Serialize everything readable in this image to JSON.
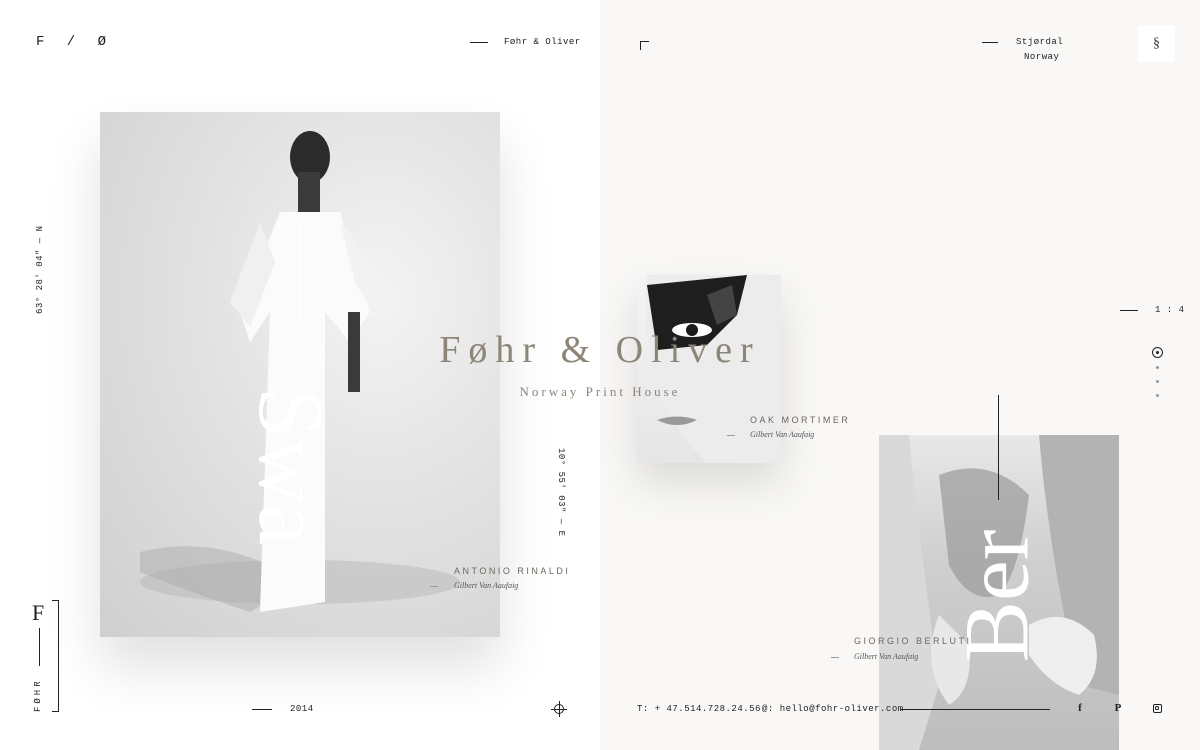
{
  "brand": {
    "logo": "F / Ø",
    "header_name": "Føhr & Oliver",
    "title": "Føhr & Oliver",
    "subtitle": "Norway Print House",
    "side_mark": "FØHR"
  },
  "location": {
    "city": "Stjørdal",
    "country": "Norway",
    "latitude": "63° 28' 04\" — N",
    "longitude": "10° 55' 03\" — E"
  },
  "slider": {
    "counter": "1 : 4"
  },
  "year": "2014",
  "contact": {
    "phone": "T: + 47.514.728.24.56",
    "email": "@: hello@fohr-oliver.com"
  },
  "works": [
    {
      "name": "ANTONIO RINALDI",
      "author": "Gilbert Van Aaufaig",
      "word": "Swa"
    },
    {
      "name": "OAK MORTIMER",
      "author": "Gilbert Van Aaufaig"
    },
    {
      "name": "GIORGIO BERLUTI",
      "author": "Gilbert Van Aaufaig",
      "word": "Ber"
    }
  ],
  "icons": {
    "menu": "dollar-s-icon",
    "social": [
      "facebook-icon",
      "pinterest-icon",
      "instagram-icon"
    ],
    "nav_active": "target-icon",
    "crosshair": "crosshair-icon"
  }
}
